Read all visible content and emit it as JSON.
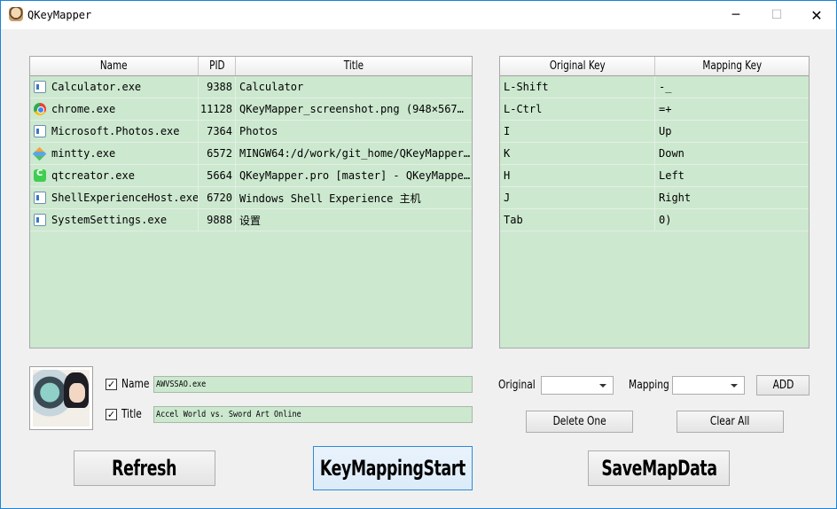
{
  "window": {
    "title": "QKeyMapper",
    "minimize_glyph": "─",
    "maximize_glyph": "☐",
    "close_glyph": "✕"
  },
  "process_table": {
    "headers": [
      "Name",
      "PID",
      "Title"
    ],
    "rows": [
      {
        "icon": "window-icon",
        "name": "Calculator.exe",
        "pid": "9388",
        "title": "Calculator"
      },
      {
        "icon": "chrome-icon",
        "name": "chrome.exe",
        "pid": "11128",
        "title": "QKeyMapper_screenshot.png (948×567…"
      },
      {
        "icon": "window-icon",
        "name": "Microsoft.Photos.exe",
        "pid": "7364",
        "title": "Photos"
      },
      {
        "icon": "mintty-icon",
        "name": "mintty.exe",
        "pid": "6572",
        "title": "MINGW64:/d/work/git_home/QKeyMapper…"
      },
      {
        "icon": "qtcreator-icon",
        "name": "qtcreator.exe",
        "pid": "5664",
        "title": "QKeyMapper.pro [master] - QKeyMappe…"
      },
      {
        "icon": "window-icon",
        "name": "ShellExperienceHost.exe",
        "pid": "6720",
        "title": "Windows Shell Experience 主机"
      },
      {
        "icon": "window-icon",
        "name": "SystemSettings.exe",
        "pid": "9888",
        "title": "设置"
      }
    ]
  },
  "mapping_table": {
    "headers": [
      "Original Key",
      "Mapping Key"
    ],
    "rows": [
      {
        "original": "L-Shift",
        "mapping": "-_"
      },
      {
        "original": "L-Ctrl",
        "mapping": "=+"
      },
      {
        "original": "I",
        "mapping": "Up"
      },
      {
        "original": "K",
        "mapping": "Down"
      },
      {
        "original": "H",
        "mapping": "Left"
      },
      {
        "original": "J",
        "mapping": "Right"
      },
      {
        "original": "Tab",
        "mapping": "0)"
      }
    ]
  },
  "selected_process": {
    "name_checked": true,
    "name_label": "Name",
    "name_value": "AWVSSAO.exe",
    "title_checked": true,
    "title_label": "Title",
    "title_value": "Accel World vs. Sword Art Online",
    "check_glyph": "✓"
  },
  "mapping_editor": {
    "original_label": "Original",
    "original_value": "",
    "mapping_label": "Mapping",
    "mapping_value": "",
    "add_label": "ADD",
    "delete_one_label": "Delete One",
    "clear_all_label": "Clear All"
  },
  "actions": {
    "refresh_label": "Refresh",
    "start_label": "KeyMappingStart",
    "save_label": "SaveMapData"
  },
  "colors": {
    "table_bg": "#cce8cf",
    "window_border": "#1883d7",
    "focus_border": "#2f8ad8"
  }
}
